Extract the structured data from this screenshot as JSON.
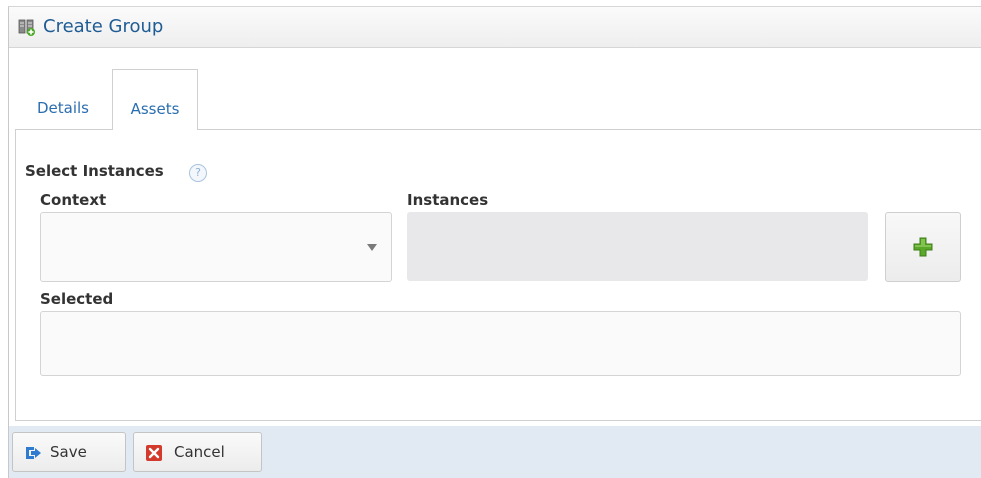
{
  "dialog": {
    "title": "Create Group",
    "title_icon": "server-group-icon"
  },
  "tabs": [
    {
      "label": "Details",
      "active": false
    },
    {
      "label": "Assets",
      "active": true
    }
  ],
  "select_instances": {
    "heading": "Select Instances",
    "help_glyph": "?",
    "context": {
      "label": "Context",
      "value": ""
    },
    "instances": {
      "label": "Instances",
      "value": ""
    },
    "add_icon": "green-plus-icon",
    "selected": {
      "label": "Selected",
      "value": ""
    }
  },
  "footer": {
    "save_label": "Save",
    "save_icon": "save-arrow-icon",
    "cancel_label": "Cancel",
    "cancel_icon": "red-x-icon"
  },
  "colors": {
    "title_text": "#1f5c94",
    "tab_text": "#2a6eb0",
    "footer_bg": "#e1e9f3",
    "add_green": "#5aa82a",
    "cancel_red": "#d33a2c",
    "save_blue": "#2e7bcf"
  }
}
